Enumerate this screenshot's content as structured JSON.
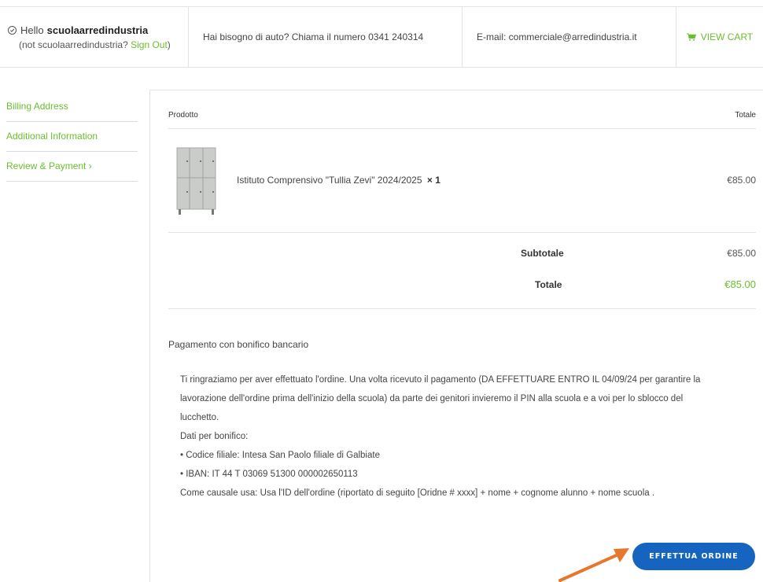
{
  "header": {
    "greeting": "Hello",
    "username": "scuolaarredindustria",
    "not_user_prefix": "(not scuolaarredindustria?",
    "sign_out": "Sign Out",
    "not_user_suffix": ")",
    "phone_text": "Hai bisogno di auto? Chiama il numero 0341 240314",
    "email_text": "E-mail: commerciale@arredindustria.it",
    "cart_label": "VIEW CART",
    "cart_icon": "cart-icon",
    "check_icon": "check-circle-icon"
  },
  "sidebar": {
    "items": [
      {
        "label": "Billing Address"
      },
      {
        "label": "Additional Information"
      },
      {
        "label": "Review & Payment ›"
      }
    ]
  },
  "order": {
    "col_product": "Prodotto",
    "col_total": "Totale",
    "product_name": "Istituto Comprensivo \"Tullia Zevi\" 2024/2025",
    "product_qty": "× 1",
    "product_price": "€85.00",
    "subtotal_label": "Subtotale",
    "subtotal_value": "€85.00",
    "total_label": "Totale",
    "total_value": "€85.00"
  },
  "payment": {
    "method": "Pagamento con bonifico bancario",
    "lines": [
      "Ti ringraziamo per aver effettuato l'ordine. Una volta ricevuto il pagamento (DA EFFETTUARE ENTRO IL 04/09/24 per garantire la",
      "lavorazione dell'ordine prima dell'inizio della scuola) da parte dei genitori invieremo il PIN alla scuola e a voi per lo sblocco del",
      "lucchetto.",
      "Dati per bonifico:",
      "• Codice filiale: Intesa San Paolo filiale di Galbiate",
      "• IBAN: IT 44 T 03069 51300 000002650113",
      "Come causale usa: Usa l'ID dell'ordine (riportato di seguito [Oridne # xxxx] + nome + cognome alunno + nome scuola ."
    ]
  },
  "actions": {
    "place_order": "EFFETTUA ORDINE"
  },
  "colors": {
    "accent_green": "#6abf2c",
    "button_blue": "#1565c0",
    "arrow_orange": "#e8772e"
  }
}
